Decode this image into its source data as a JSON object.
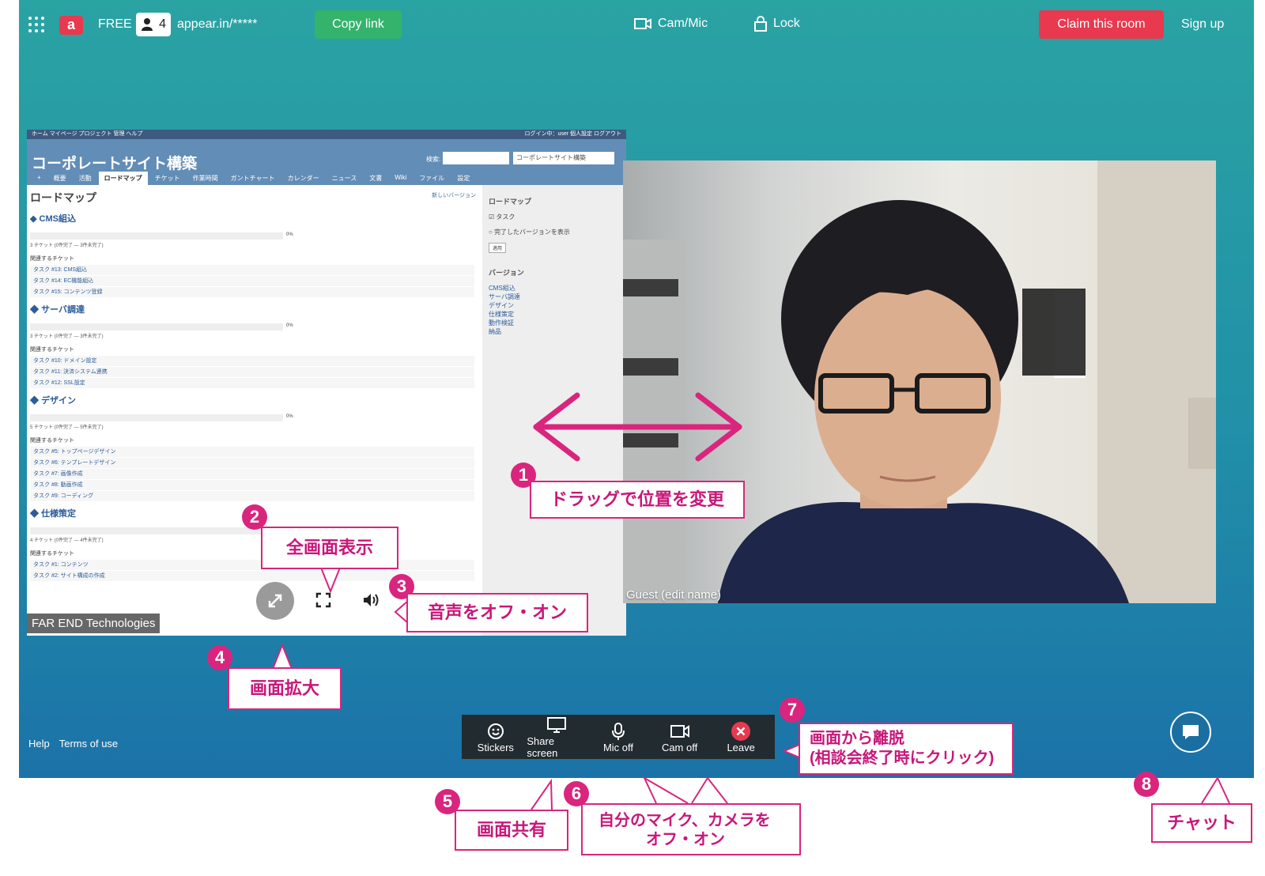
{
  "colors": {
    "brand_red": "#e8394f",
    "copy_green": "#33b36c",
    "annotation_pink": "#d9257d",
    "control_bar": "#222b30"
  },
  "topbar": {
    "menu_icon": "grid-icon",
    "logo_text": "a",
    "plan": "FREE",
    "user_count": "4",
    "room_url": "appear.in/*****",
    "copy_label": "Copy link",
    "cammic_label": "Cam/Mic",
    "lock_label": "Lock",
    "claim_label": "Claim this room",
    "signup_label": "Sign up"
  },
  "shared_screen": {
    "label": "FAR END Technologies",
    "redmine": {
      "top_menu": "ホーム  マイページ  プロジェクト  管理  ヘルプ",
      "login_info": "ログイン中：user   個人設定  ログアウト",
      "project_title": "コーポレートサイト構築",
      "search_label": "検索:",
      "project_select": "コーポレートサイト構築",
      "tabs": [
        "+",
        "概要",
        "活動",
        "ロードマップ",
        "チケット",
        "作業時間",
        "ガントチャート",
        "カレンダー",
        "ニュース",
        "文書",
        "Wiki",
        "ファイル",
        "設定"
      ],
      "active_tab": "ロードマップ",
      "page_heading": "ロードマップ",
      "new_version": "新しいバージョン",
      "related_label": "関連するチケット",
      "versions": [
        {
          "name": "CMS組込",
          "percent": "0%",
          "meta": "3 チケット (0件完了 — 3件未完了)",
          "tickets": [
            "タスク #13: CMS組込",
            "タスク #14: EC機能組込",
            "タスク #15: コンテンツ登録"
          ]
        },
        {
          "name": "サーバ調達",
          "percent": "0%",
          "meta": "3 チケット (0件完了 — 3件未完了)",
          "tickets": [
            "タスク #10: ドメイン設定",
            "タスク #11: 決済システム連携",
            "タスク #12: SSL設定"
          ]
        },
        {
          "name": "デザイン",
          "percent": "0%",
          "meta": "5 チケット (0件完了 — 5件未完了)",
          "tickets": [
            "タスク #5: トップページデザイン",
            "タスク #6: テンプレートデザイン",
            "タスク #7: 画像作成",
            "タスク #8: 動画作成",
            "タスク #9: コーディング"
          ]
        },
        {
          "name": "仕様策定",
          "percent": "0%",
          "meta": "4 チケット (0件完了 — 4件未完了)",
          "tickets": [
            "タスク #1: コンテンツ",
            "タスク #2: サイト構成の作成"
          ]
        }
      ],
      "sidebar": {
        "title": "ロードマップ",
        "option_task": "タスク",
        "option_completed": "完了したバージョンを表示",
        "apply": "適用",
        "versions_title": "バージョン",
        "version_links": [
          "CMS組込",
          "サーバ調達",
          "デザイン",
          "仕様策定",
          "動作検証",
          "納品"
        ]
      }
    }
  },
  "webcam": {
    "label": "Guest (edit name)"
  },
  "footer": {
    "help": "Help",
    "terms": "Terms of use"
  },
  "controls": [
    {
      "label": "Stickers",
      "icon": "smiley-icon"
    },
    {
      "label": "Share screen",
      "icon": "monitor-icon"
    },
    {
      "label": "Mic off",
      "icon": "microphone-icon"
    },
    {
      "label": "Cam off",
      "icon": "camera-icon"
    },
    {
      "label": "Leave",
      "icon": "close-icon"
    }
  ],
  "annotations": {
    "n1": "1",
    "drag": "ドラッグで位置を変更",
    "n2": "2",
    "fullscreen": "全画面表示",
    "n3": "3",
    "mute": "音声をオフ・オン",
    "n4": "4",
    "zoom": "画面拡大",
    "n5": "5",
    "share": "画面共有",
    "n6": "6",
    "micam": "自分のマイク、カメラを\n　　　オフ・オン",
    "n7": "7",
    "leave": "画面から離脱\n(相談会終了時にクリック)",
    "n8": "8",
    "chat": "チャット"
  }
}
